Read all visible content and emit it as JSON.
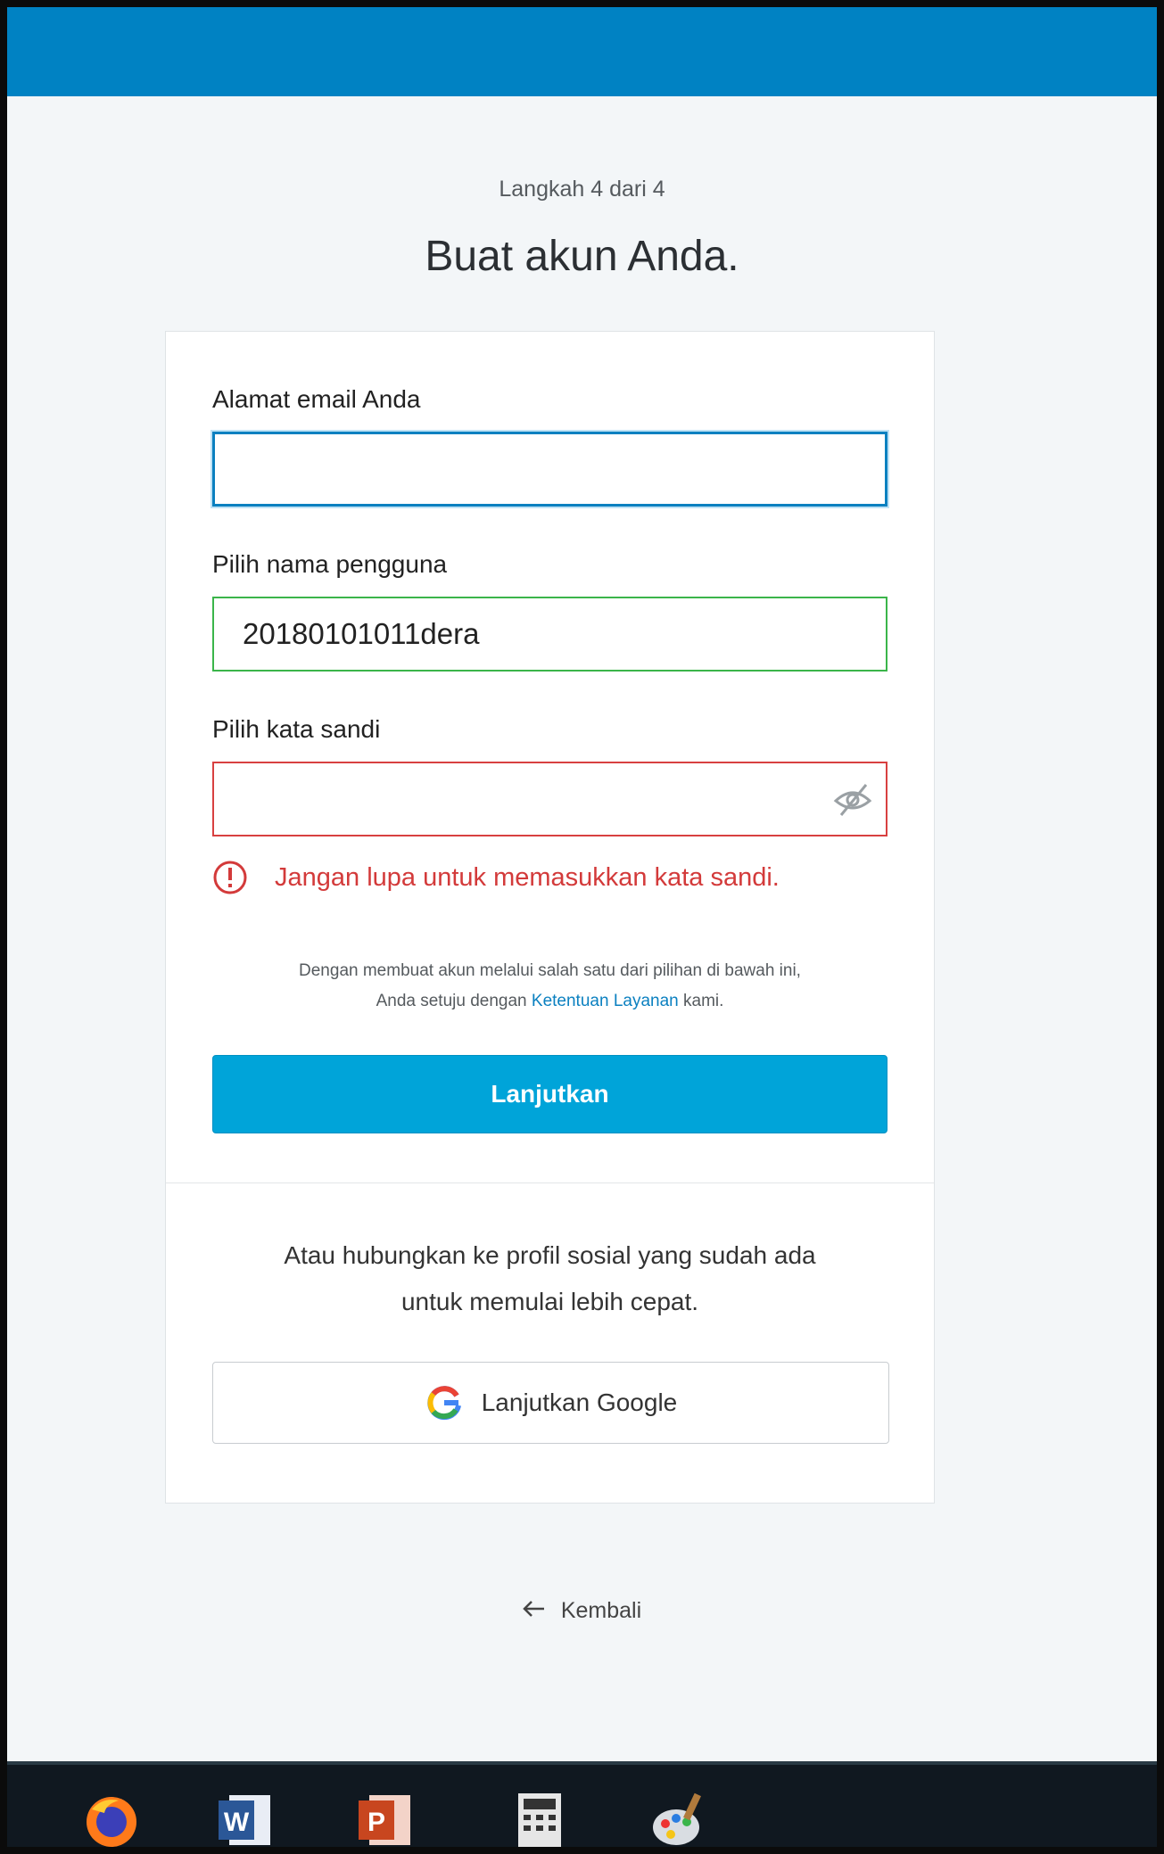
{
  "header": {
    "step": "Langkah 4 dari 4",
    "title": "Buat akun Anda."
  },
  "form": {
    "email_label": "Alamat email Anda",
    "email_value": "",
    "username_label": "Pilih nama pengguna",
    "username_value": "20180101011dera",
    "password_label": "Pilih kata sandi",
    "password_value": "",
    "password_error": "Jangan lupa untuk memasukkan kata sandi.",
    "terms_text_1": "Dengan membuat akun melalui salah satu dari pilihan di bawah ini,",
    "terms_text_2_prefix": "Anda setuju dengan",
    "terms_link": "Ketentuan Layanan",
    "terms_text_2_suffix": "kami.",
    "continue_label": "Lanjutkan"
  },
  "social": {
    "text_line1": "Atau hubungkan ke profil sosial yang sudah ada",
    "text_line2": "untuk memulai lebih cepat.",
    "google_label": "Lanjutkan Google"
  },
  "back_label": "Kembali",
  "taskbar": {
    "apps": [
      "firefox-icon",
      "word-icon",
      "powerpoint-icon",
      "calculator-icon",
      "paint-icon"
    ]
  },
  "colors": {
    "topbar": "#0082c3",
    "primary_button": "#00a4d9",
    "error": "#d33a3a",
    "valid": "#3bb54a",
    "focus": "#0b80c0"
  }
}
